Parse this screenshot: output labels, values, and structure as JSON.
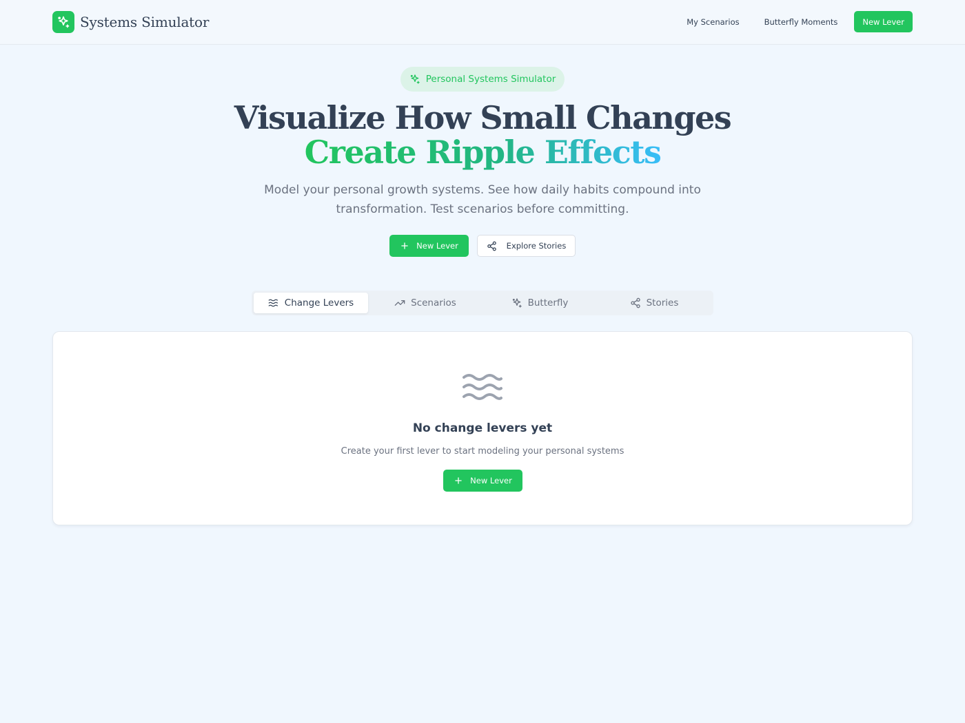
{
  "header": {
    "app_name": "Systems Simulator",
    "logo_icon": "sparkles-icon",
    "nav": {
      "my_scenarios": "My Scenarios",
      "butterfly_moments": "Butterfly Moments",
      "new_lever": "New Lever"
    }
  },
  "hero": {
    "badge": "Personal Systems Simulator",
    "title_line1": "Visualize How Small Changes",
    "title_line2": "Create Ripple Effects",
    "subtitle": "Model your personal growth systems. See how daily habits compound into transformation. Test scenarios before committing.",
    "primary_button": "New Lever",
    "secondary_button": "Explore Stories"
  },
  "tabs": [
    {
      "label": "Change Levers",
      "icon": "waves-icon",
      "active": true
    },
    {
      "label": "Scenarios",
      "icon": "trending-up-icon",
      "active": false
    },
    {
      "label": "Butterfly",
      "icon": "sparkles-icon",
      "active": false
    },
    {
      "label": "Stories",
      "icon": "share-icon",
      "active": false
    }
  ],
  "empty_state": {
    "icon": "waves-icon",
    "title": "No change levers yet",
    "subtitle": "Create your first lever to start modeling your personal systems",
    "button": "New Lever"
  },
  "colors": {
    "accent": "#22c55e",
    "background": "#f0f7fe",
    "text": "#334155",
    "muted": "#6b7280",
    "gradient_end": "#38bdf8"
  }
}
